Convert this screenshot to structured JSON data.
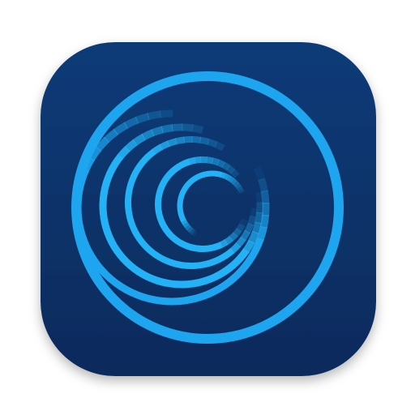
{
  "icon": {
    "name": "spiral-rings-app-icon",
    "colors": {
      "background_top": "#0b3b78",
      "background_bottom": "#0a2a5c",
      "accent": "#1da6ef",
      "accent_light": "#22b2f5"
    }
  }
}
